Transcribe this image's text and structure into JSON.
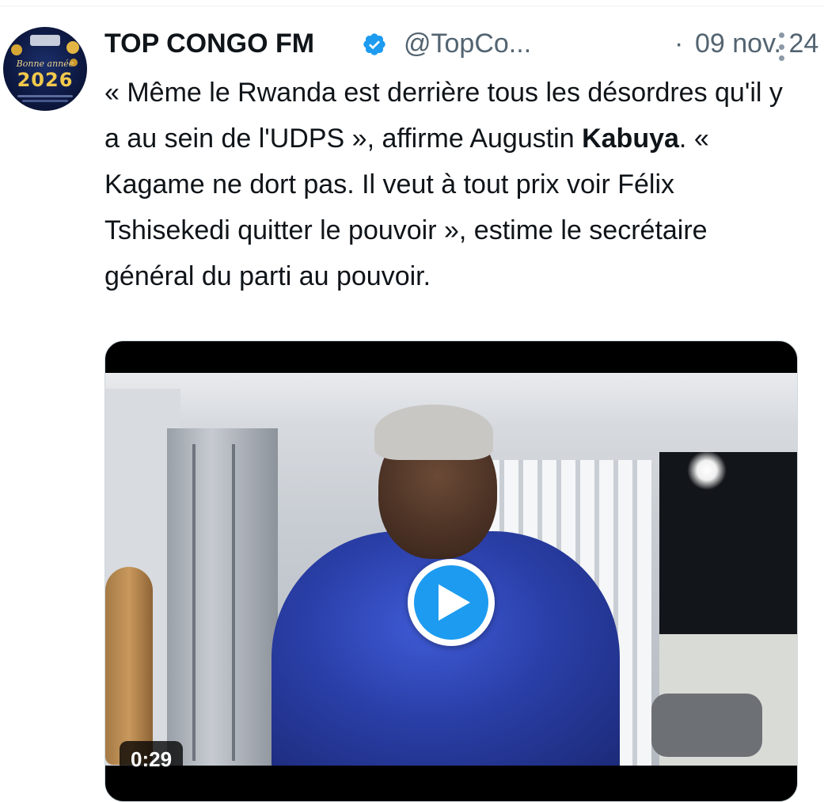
{
  "tweet": {
    "author": {
      "display_name": "TOP CONGO FM",
      "handle": "@TopCo...",
      "verified": true,
      "avatar": {
        "script_text": "Bonne année",
        "year_text": "2026"
      }
    },
    "separator": "·",
    "timestamp": "09 nov. 24",
    "more_icon": "more-vertical-icon",
    "text": {
      "part1": "« Même le Rwanda est derrière tous les désordres qu'il y a au sein de l'UDPS », affirme Augustin ",
      "bold": "Kabuya",
      "part2": ". « Kagame ne dort pas. Il veut à tout prix voir Félix Tshisekedi quitter le pouvoir », estime le secrétaire général du parti au pouvoir."
    },
    "media": {
      "type": "video",
      "duration": "0:29",
      "play_icon": "play-icon"
    }
  },
  "colors": {
    "accent": "#1d9bf0",
    "text_primary": "#0f1419",
    "text_secondary": "#536471"
  }
}
